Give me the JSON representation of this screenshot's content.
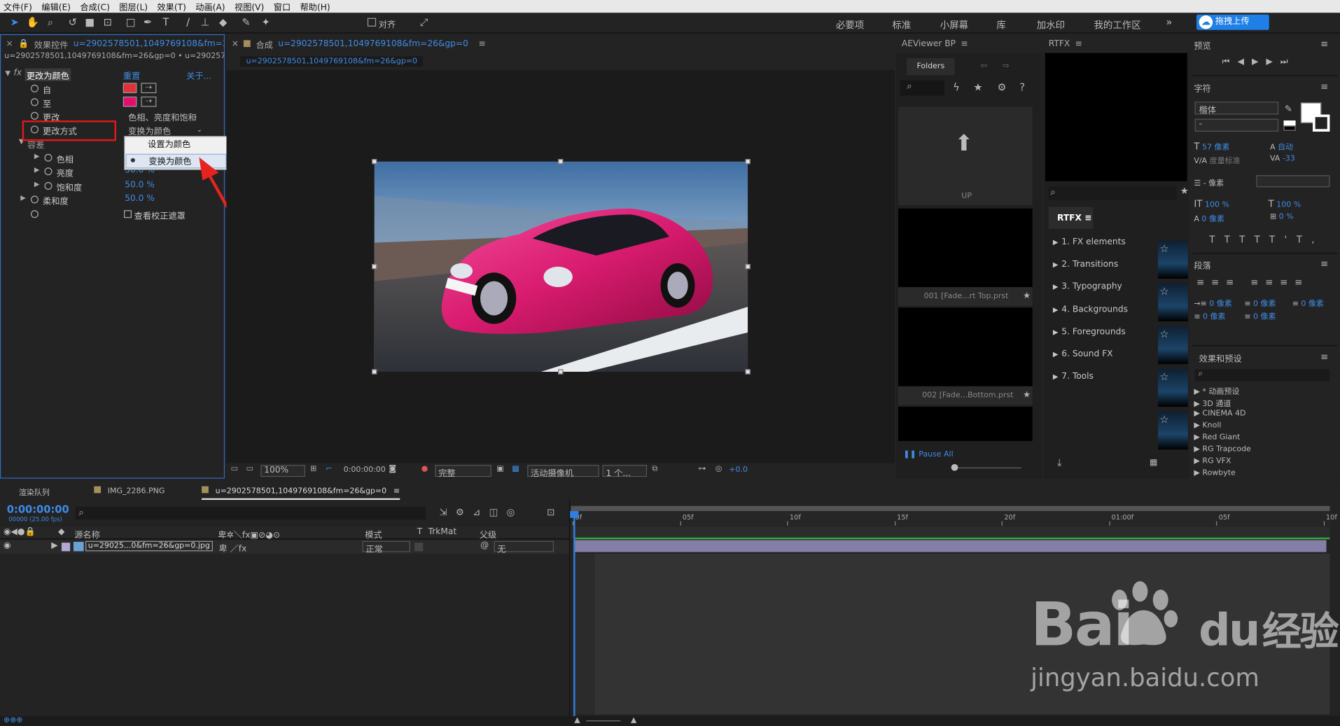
{
  "menu": [
    "文件(F)",
    "编辑(E)",
    "合成(C)",
    "图层(L)",
    "效果(T)",
    "动画(A)",
    "视图(V)",
    "窗口",
    "帮助(H)"
  ],
  "toolbar": {
    "align_label": "对齐",
    "workspaces": [
      "必要项",
      "标准",
      "小屏幕",
      "库",
      "加水印",
      "我的工作区"
    ],
    "upload_label": "拖拽上传"
  },
  "effects_panel": {
    "tab": "效果控件",
    "layer_name": "u=2902578501,1049769108&fm=2",
    "breadcrumb": "u=2902578501,1049769108&fm=26&gp=0 • u=2902578501,104",
    "effect_name": "更改为颜色",
    "reset": "重置",
    "about": "关于...",
    "props": [
      {
        "label": "自"
      },
      {
        "label": "至"
      },
      {
        "label": "更改",
        "value": "色相、亮度和饱和"
      },
      {
        "label": "更改方式",
        "value": "变换为颜色"
      },
      {
        "label": "容差"
      },
      {
        "label": "色相",
        "value": ""
      },
      {
        "label": "亮度",
        "value": "50.0 %"
      },
      {
        "label": "饱和度",
        "value": "50.0 %"
      },
      {
        "label": "柔和度",
        "value": "50.0 %"
      },
      {
        "label": "",
        "value": "查看校正遮罩"
      }
    ],
    "dropdown": [
      "设置为颜色",
      "变换为颜色"
    ],
    "from_color": "#e0303a",
    "to_color": "#e0106c",
    "highlight_color": "#e01919"
  },
  "comp": {
    "tab_prefix": "合成",
    "tab_name": "u=2902578501,1049769108&fm=26&gp=0",
    "sub_tab": "u=2902578501,1049769108&fm=26&gp=0",
    "zoom": "100%",
    "timecode": "0:00:00:00",
    "quality": "完整",
    "camera": "活动摄像机",
    "views": "1 个...",
    "exposure": "+0.0"
  },
  "aeviewer": {
    "title": "AEViewer BP",
    "folders": "Folders",
    "up": "UP",
    "item1": "001 [Fade...rt Top.prst",
    "item2": "002 [Fade...Bottom.prst",
    "pause": "Pause All"
  },
  "rtfx": {
    "title": "RTFX",
    "logo": "RTFX",
    "items": [
      "1. FX elements",
      "2. Transitions",
      "3. Typography",
      "4. Backgrounds",
      "5. Foregrounds",
      "6. Sound FX",
      "7. Tools"
    ]
  },
  "right": {
    "preview": "预览",
    "char": "字符",
    "font": "楷体",
    "font_style": "-",
    "size": "57 像素",
    "leading": "自动",
    "kerning": "度量标准",
    "tracking": "-33",
    "stroke": "- 像素",
    "vscale": "100 %",
    "hscale": "100 %",
    "baseline": "0 像素",
    "tsume": "0 %",
    "para": "段落",
    "indent": "0 像素",
    "fx_title": "效果和预设",
    "fx_items": [
      "* 动画预设",
      "3D 通道",
      "CINEMA 4D",
      "Knoll",
      "Red Giant",
      "RG Trapcode",
      "RG VFX",
      "Rowbyte"
    ]
  },
  "timeline": {
    "tabs": [
      "渲染队列",
      "IMG_2286.PNG",
      "u=2902578501,1049769108&fm=26&gp=0"
    ],
    "timecode": "0:00:00:00",
    "fps": "00000 (25.00 fps)",
    "col_source": "源名称",
    "col_mode": "模式",
    "col_t": "T",
    "col_trkmat": "TrkMat",
    "col_parent": "父级",
    "layer_name": "u=29025...0&fm=26&gp=0.jpg",
    "layer_mode": "正常",
    "layer_parent": "无",
    "ruler": [
      "0f",
      "05f",
      "10f",
      "15f",
      "20f",
      "01:00f",
      "05f",
      "10f"
    ]
  },
  "watermark": {
    "brand": "Bai",
    "brand2": "du",
    "brand3": "经验",
    "url": "jingyan.baidu.com"
  }
}
